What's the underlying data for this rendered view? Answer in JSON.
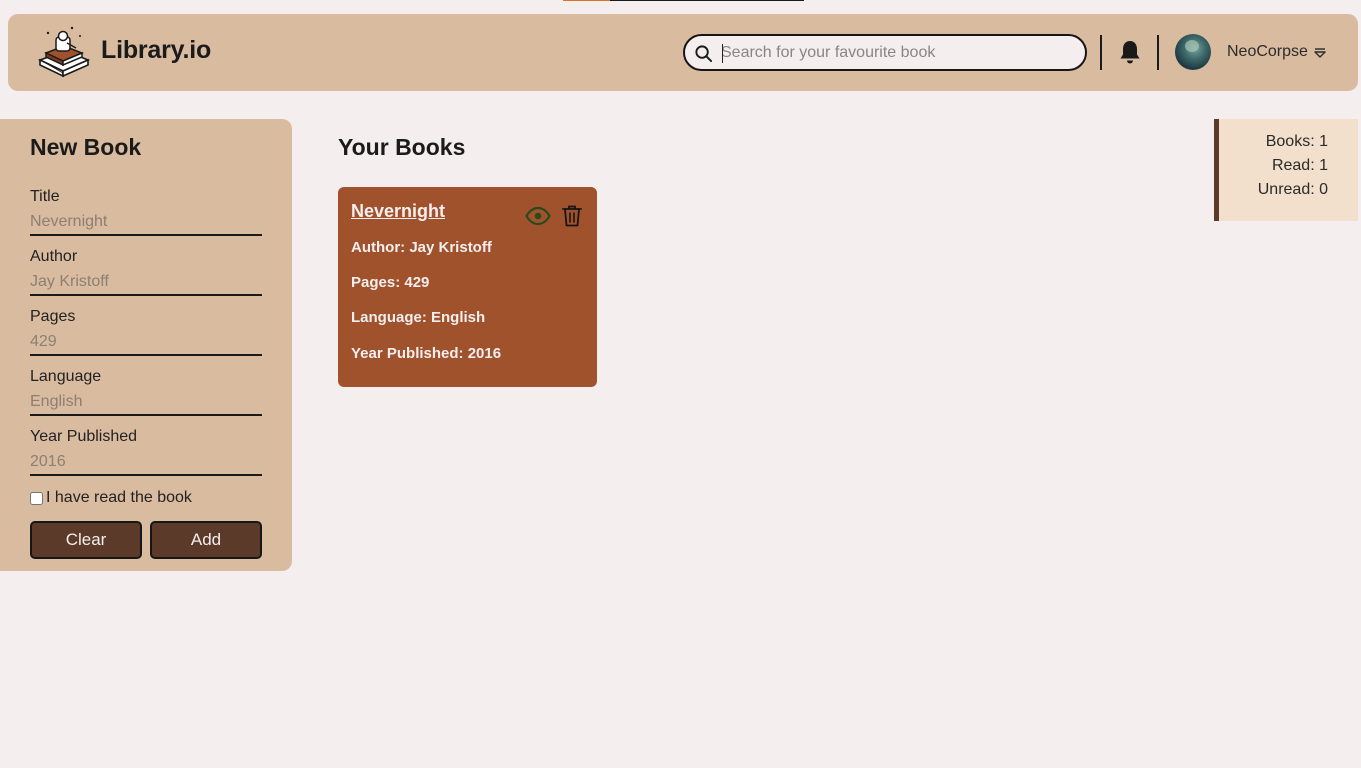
{
  "header": {
    "brand": "Library.io",
    "search": {
      "placeholder": "Search for your favourite book",
      "value": ""
    },
    "user": {
      "name": "NeoCorpse"
    }
  },
  "sidebar": {
    "title": "New Book",
    "fields": [
      {
        "label": "Title",
        "placeholder": "Nevernight"
      },
      {
        "label": "Author",
        "placeholder": "Jay Kristoff"
      },
      {
        "label": "Pages",
        "placeholder": "429"
      },
      {
        "label": "Language",
        "placeholder": "English"
      },
      {
        "label": "Year Published",
        "placeholder": "2016"
      }
    ],
    "read_checkbox_label": "I have read the book",
    "clear_label": "Clear",
    "add_label": "Add"
  },
  "main": {
    "title": "Your Books",
    "books": [
      {
        "title": "Nevernight",
        "author": "Author: Jay Kristoff",
        "pages": "Pages: 429",
        "language": "Language: English",
        "year": "Year Published: 2016"
      }
    ]
  },
  "stats": {
    "books": "Books: 1",
    "read": "Read: 1",
    "unread": "Unread: 0"
  },
  "colors": {
    "background": "#f5eeee",
    "panel": "#d9bb9f",
    "card": "#a0522d",
    "button": "#5b3a2a",
    "stats_panel": "#f2dfcc",
    "read_eye": "#2a4a1e",
    "progress_accent": "#d9742b"
  },
  "icons": [
    "library-logo-icon",
    "search-icon",
    "bell-icon",
    "chevron-down-icon",
    "eye-icon",
    "trash-icon"
  ]
}
